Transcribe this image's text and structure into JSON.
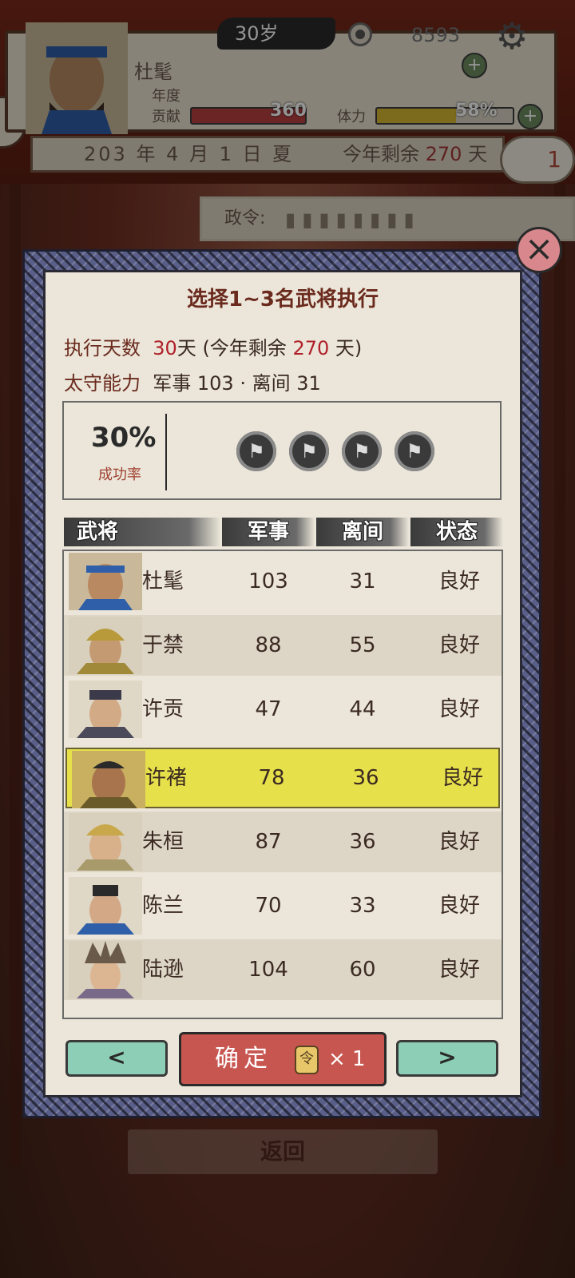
{
  "header": {
    "name": "杜髦",
    "age": "30岁",
    "coins": "8593",
    "year_label": "年度",
    "contrib_label": "贡献",
    "contribution": "360",
    "stamina_label": "体力",
    "stamina": "58%",
    "stamina_fraction": 0.58,
    "plus": "+"
  },
  "date_bar": {
    "date": "203 年 4 月 1 日 夏",
    "remain_prefix": "今年剩余",
    "remain_days": "270",
    "remain_suffix": "天",
    "cloud_number": "1"
  },
  "policy": {
    "label": "政令:"
  },
  "modal": {
    "title": "选择1~3名武将执行",
    "days_label": "执行天数",
    "days_value": "30",
    "days_suffix": "天 (今年剩余",
    "days_remain": "270",
    "days_close": "天)",
    "ability_label": "太守能力",
    "ability_value": "军事 103 · 离间 31",
    "success_rate": "30%",
    "success_label": "成功率",
    "slots": 4,
    "columns": [
      "武将",
      "军事",
      "离间",
      "状态"
    ],
    "rows": [
      {
        "name": "杜髦",
        "military": "103",
        "sow": "31",
        "status": "良好"
      },
      {
        "name": "于禁",
        "military": "88",
        "sow": "55",
        "status": "良好"
      },
      {
        "name": "许贡",
        "military": "47",
        "sow": "44",
        "status": "良好"
      },
      {
        "name": "许褚",
        "military": "78",
        "sow": "36",
        "status": "良好",
        "selected": true
      },
      {
        "name": "朱桓",
        "military": "87",
        "sow": "36",
        "status": "良好"
      },
      {
        "name": "陈兰",
        "military": "70",
        "sow": "33",
        "status": "良好"
      },
      {
        "name": "陆逊",
        "military": "104",
        "sow": "60",
        "status": "良好"
      }
    ],
    "prev": "<",
    "next": ">",
    "confirm": "确定",
    "cost": "× 1"
  },
  "back": "返回",
  "colors": {
    "accent_red": "#b0202a",
    "selected_row": "#e6e04a",
    "confirm": "#c85650",
    "nav": "#8dcfb6"
  }
}
